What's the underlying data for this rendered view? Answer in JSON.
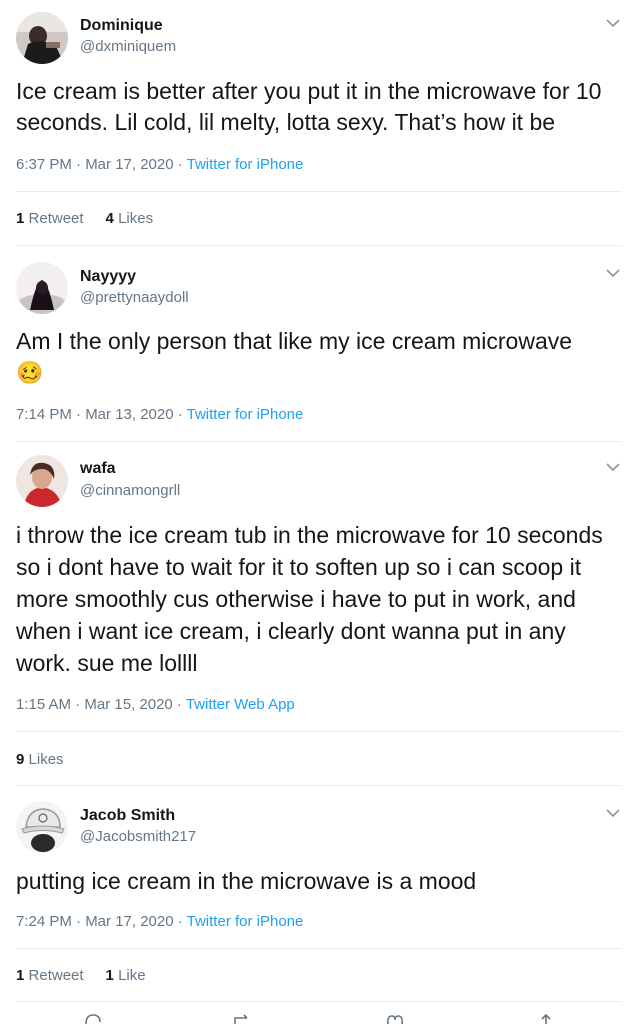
{
  "tweets": [
    {
      "name": "Dominique",
      "handle": "@dxminiquem",
      "text": "Ice cream is better after you put it in the microwave for 10 seconds. Lil cold, lil melty, lotta sexy. That’s how it be",
      "time": "6:37 PM · Mar 17, 2020 · ",
      "source": "Twitter for iPhone",
      "retweets_count": "1",
      "retweets_label": "Retweet",
      "likes_count": "4",
      "likes_label": "Likes"
    },
    {
      "name": "Nayyyy",
      "handle": "@prettynaaydoll",
      "text": "Am I the only person that like my ice cream microwave",
      "emoji": "🥴",
      "time": "7:14 PM · Mar 13, 2020 · ",
      "source": "Twitter for iPhone"
    },
    {
      "name": "wafa",
      "handle": "@cinnamongrll",
      "text": "i throw the ice cream tub in the microwave for 10 seconds so i dont have to wait for it to soften up so i can scoop it more smoothly cus otherwise i have to put in work, and when i want ice cream, i clearly dont wanna put in any work. sue me lollll",
      "time": "1:15 AM · Mar 15, 2020 · ",
      "source": "Twitter Web App",
      "likes_count": "9",
      "likes_label": "Likes"
    },
    {
      "name": "Jacob Smith",
      "handle": "@Jacobsmith217",
      "text": "putting ice cream in the microwave is a mood",
      "time": "7:24 PM · Mar 17, 2020 · ",
      "source": "Twitter for iPhone",
      "retweets_count": "1",
      "retweets_label": "Retweet",
      "likes_count": "1",
      "likes_label": "Like"
    }
  ],
  "colors": {
    "link": "#1da1f2",
    "muted": "#657786",
    "divider": "#e6ecf0",
    "text": "#14171a"
  },
  "icons": [
    "chevron-down-icon",
    "reply-icon",
    "retweet-icon",
    "like-icon",
    "share-icon"
  ]
}
